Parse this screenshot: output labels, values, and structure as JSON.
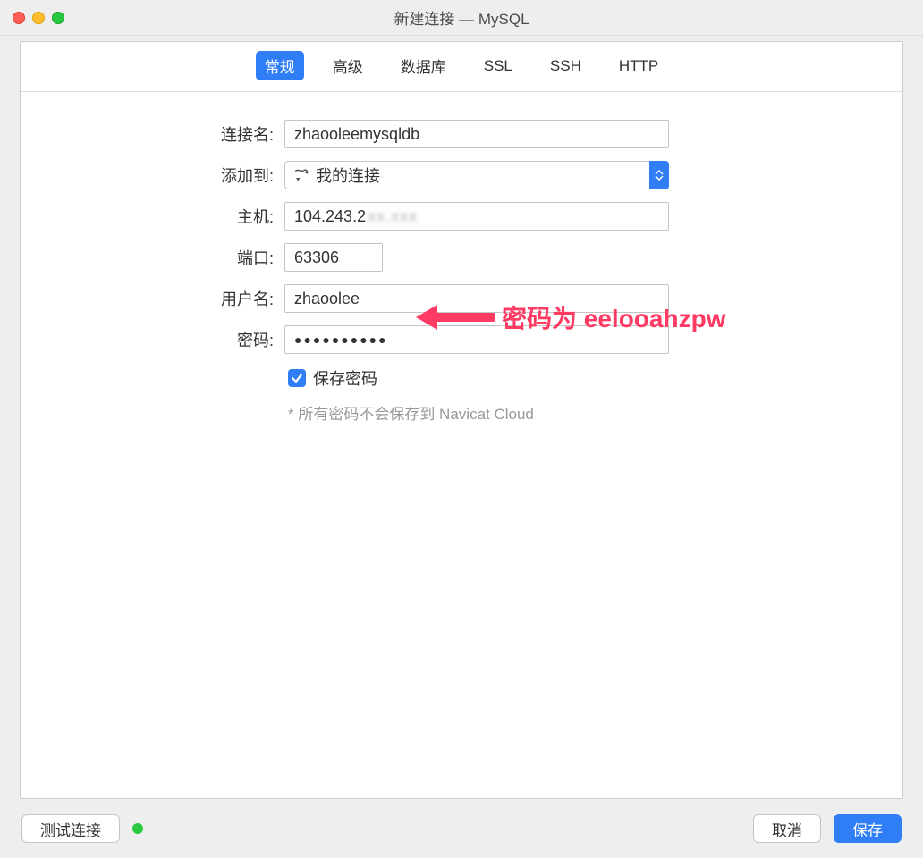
{
  "window": {
    "title": "新建连接 — MySQL"
  },
  "tabs": {
    "items": [
      "常规",
      "高级",
      "数据库",
      "SSL",
      "SSH",
      "HTTP"
    ],
    "active": "常规"
  },
  "form": {
    "connection_name_label": "连接名:",
    "connection_name_value": "zhaooleemysqldb",
    "add_to_label": "添加到:",
    "add_to_value": "我的连接",
    "host_label": "主机:",
    "host_value_visible": "104.243.2",
    "host_value_blurred": "xx.xxx",
    "port_label": "端口:",
    "port_value": "63306",
    "username_label": "用户名:",
    "username_value": "zhaoolee",
    "password_label": "密码:",
    "password_value": "●●●●●●●●●●",
    "save_password_label": "保存密码",
    "save_password_checked": true,
    "hint_text": "* 所有密码不会保存到 Navicat Cloud"
  },
  "annotation": {
    "text": "密码为 eelooahzpw"
  },
  "footer": {
    "test_connection_label": "测试连接",
    "cancel_label": "取消",
    "save_label": "保存",
    "status": "ok"
  },
  "colors": {
    "accent": "#2f7ef6",
    "annotation": "#ff3b64"
  }
}
